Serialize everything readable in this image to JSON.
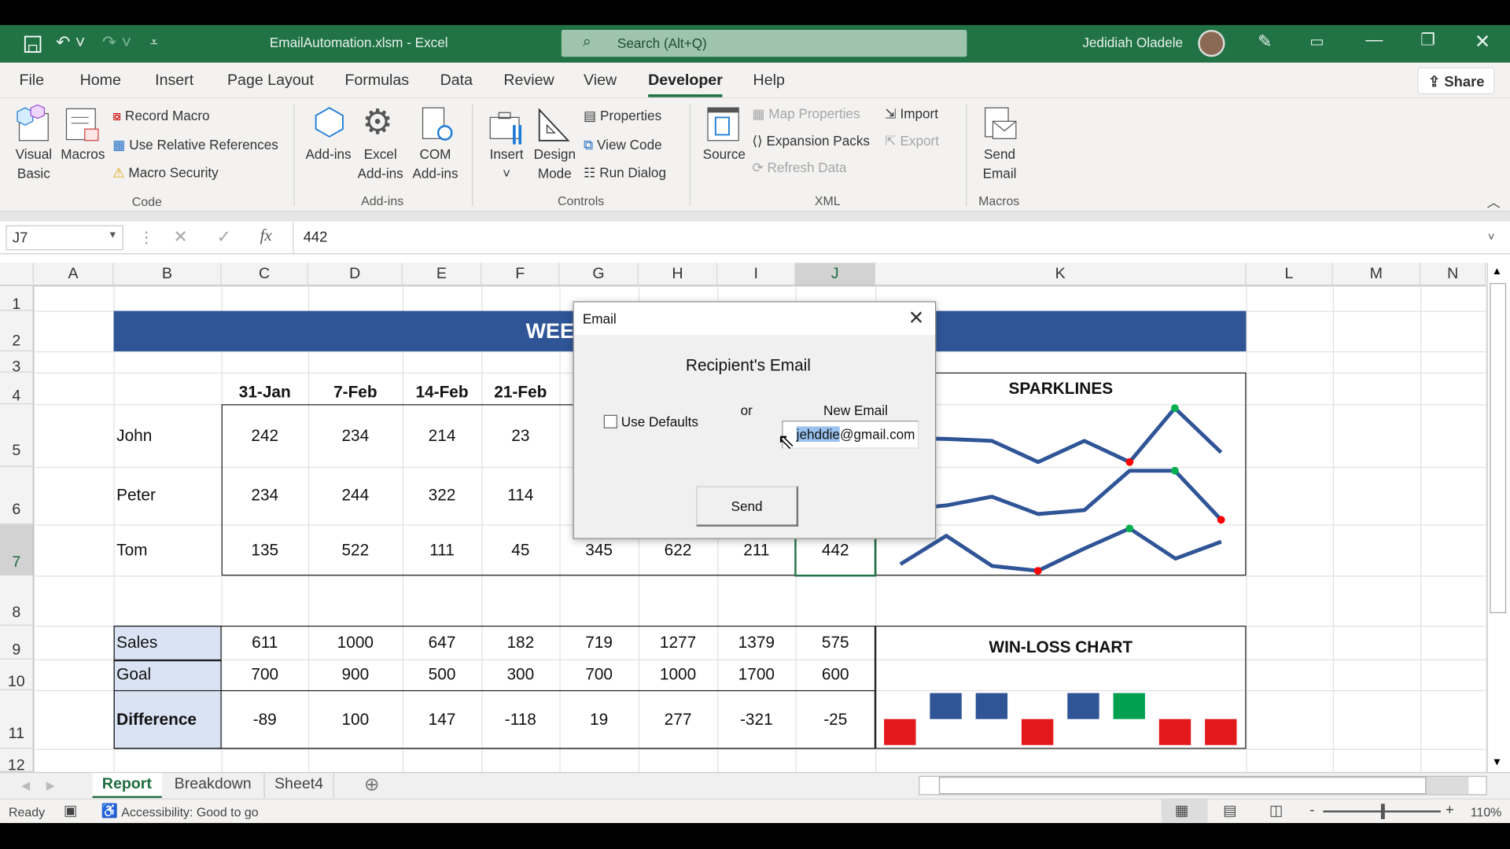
{
  "titlebar": {
    "filename": "EmailAutomation.xlsm - Excel",
    "search_placeholder": "Search (Alt+Q)",
    "user": "Jedidiah Oladele"
  },
  "ribbon_tabs": [
    "File",
    "Home",
    "Insert",
    "Page Layout",
    "Formulas",
    "Data",
    "Review",
    "View",
    "Developer",
    "Help"
  ],
  "active_tab": "Developer",
  "share": "Share",
  "ribbon": {
    "code": {
      "label": "Code",
      "visual_basic": "Visual Basic",
      "macros": "Macros",
      "record_macro": "Record Macro",
      "relative_refs": "Use Relative References",
      "macro_security": "Macro Security"
    },
    "addins": {
      "label": "Add-ins",
      "addins": "Add-ins",
      "excel_addins": "Excel Add-ins",
      "com_addins": "COM Add-ins"
    },
    "controls": {
      "label": "Controls",
      "insert": "Insert",
      "design_mode": "Design Mode",
      "properties": "Properties",
      "view_code": "View Code",
      "run_dialog": "Run Dialog"
    },
    "xml": {
      "label": "XML",
      "source": "Source",
      "map_properties": "Map Properties",
      "expansion_packs": "Expansion Packs",
      "refresh_data": "Refresh Data",
      "import": "Import",
      "export": "Export"
    },
    "macros": {
      "label": "Macros",
      "send_email": "Send Email"
    }
  },
  "formula_bar": {
    "name_box": "J7",
    "formula": "442"
  },
  "columns": [
    "A",
    "B",
    "C",
    "D",
    "E",
    "F",
    "G",
    "H",
    "I",
    "J",
    "K",
    "L",
    "M",
    "N"
  ],
  "rows": [
    "1",
    "2",
    "3",
    "4",
    "5",
    "6",
    "7",
    "8",
    "9",
    "10",
    "11",
    "12"
  ],
  "selected_cell": "J7",
  "sheet": {
    "banner_visible": "WEE",
    "dates": [
      "31-Jan",
      "7-Feb",
      "14-Feb",
      "21-Feb"
    ],
    "people": [
      {
        "name": "John",
        "values": [
          "242",
          "234",
          "214",
          "23"
        ]
      },
      {
        "name": "Peter",
        "values": [
          "234",
          "244",
          "322",
          "114"
        ]
      },
      {
        "name": "Tom",
        "values": [
          "135",
          "522",
          "111",
          "45",
          "345",
          "622",
          "211",
          "442"
        ]
      }
    ],
    "sparklines_title": "SPARKLINES",
    "summary": [
      {
        "label": "Sales",
        "values": [
          "611",
          "1000",
          "647",
          "182",
          "719",
          "1277",
          "1379",
          "575"
        ]
      },
      {
        "label": "Goal",
        "values": [
          "700",
          "900",
          "500",
          "300",
          "700",
          "1000",
          "1700",
          "600"
        ]
      },
      {
        "label": "Difference",
        "values": [
          "-89",
          "100",
          "147",
          "-118",
          "19",
          "277",
          "-321",
          "-25"
        ]
      }
    ],
    "winloss_title": "WIN-LOSS CHART"
  },
  "colors": {
    "excel_green": "#217346",
    "banner_blue": "#2f5597",
    "label_fill": "#dae3f3",
    "win": "#2f5597",
    "loss": "#e31a1c",
    "max": "#00a050",
    "spark_low": "#ff0000",
    "spark_high": "#00b050"
  },
  "dialog": {
    "title": "Email",
    "heading": "Recipient's Email",
    "use_defaults": "Use Defaults",
    "use_defaults_checked": false,
    "or": "or",
    "new_email_label": "New Email",
    "email_selected": "jehddie",
    "email_rest": "@gmail.com",
    "send": "Send"
  },
  "sheet_tabs": [
    "Report",
    "Breakdown",
    "Sheet4"
  ],
  "active_sheet": "Report",
  "status": {
    "ready": "Ready",
    "accessibility": "Accessibility: Good to go",
    "zoom": "110%"
  }
}
